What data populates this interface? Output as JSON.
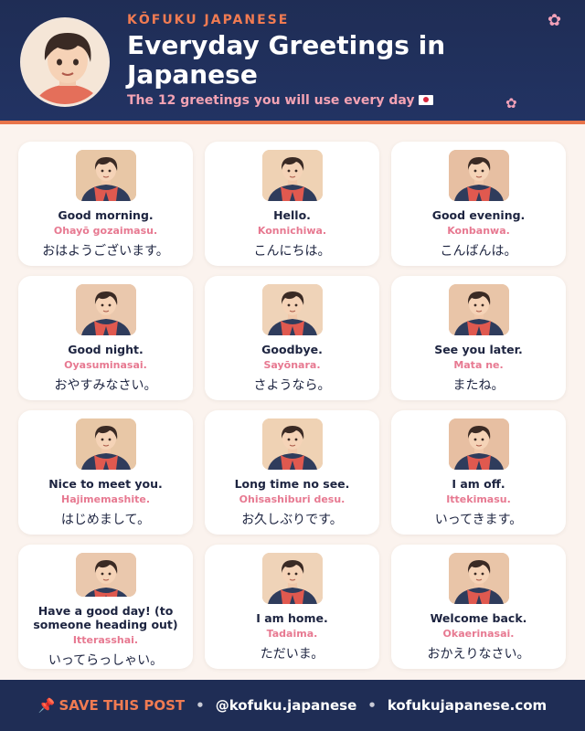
{
  "header": {
    "brand": "KŌFUKU JAPANESE",
    "title": "Everyday Greetings in Japanese",
    "subtitle": "The 12 greetings you will use every day",
    "blossom_icon": "cherry-blossom-icon"
  },
  "cards": [
    {
      "en": "Good morning.",
      "romaji": "Ohayō gozaimasu.",
      "jp": "おはようございます。"
    },
    {
      "en": "Hello.",
      "romaji": "Konnichiwa.",
      "jp": "こんにちは。"
    },
    {
      "en": "Good evening.",
      "romaji": "Konbanwa.",
      "jp": "こんばんは。"
    },
    {
      "en": "Good night.",
      "romaji": "Oyasuminasai.",
      "jp": "おやすみなさい。"
    },
    {
      "en": "Goodbye.",
      "romaji": "Sayōnara.",
      "jp": "さようなら。"
    },
    {
      "en": "See you later.",
      "romaji": "Mata ne.",
      "jp": "またね。"
    },
    {
      "en": "Nice to meet you.",
      "romaji": "Hajimemashite.",
      "jp": "はじめまして。"
    },
    {
      "en": "Long time no see.",
      "romaji": "Ohisashiburi desu.",
      "jp": "お久しぶりです。"
    },
    {
      "en": "I am off.",
      "romaji": "Ittekimasu.",
      "jp": "いってきます。"
    },
    {
      "en": "Have a good day! (to someone heading out)",
      "romaji": "Itterasshai.",
      "jp": "いってらっしゃい。"
    },
    {
      "en": "I am home.",
      "romaji": "Tadaima.",
      "jp": "ただいま。"
    },
    {
      "en": "Welcome back.",
      "romaji": "Okaerinasai.",
      "jp": "おかえりなさい。"
    }
  ],
  "footer": {
    "save": "SAVE THIS POST",
    "handle": "@kofuku.japanese",
    "website": "kofukujapanese.com",
    "separator": "•"
  },
  "colors": {
    "navy": "#1f2d55",
    "accent_orange": "#f07b52",
    "romaji_pink": "#e77991"
  }
}
